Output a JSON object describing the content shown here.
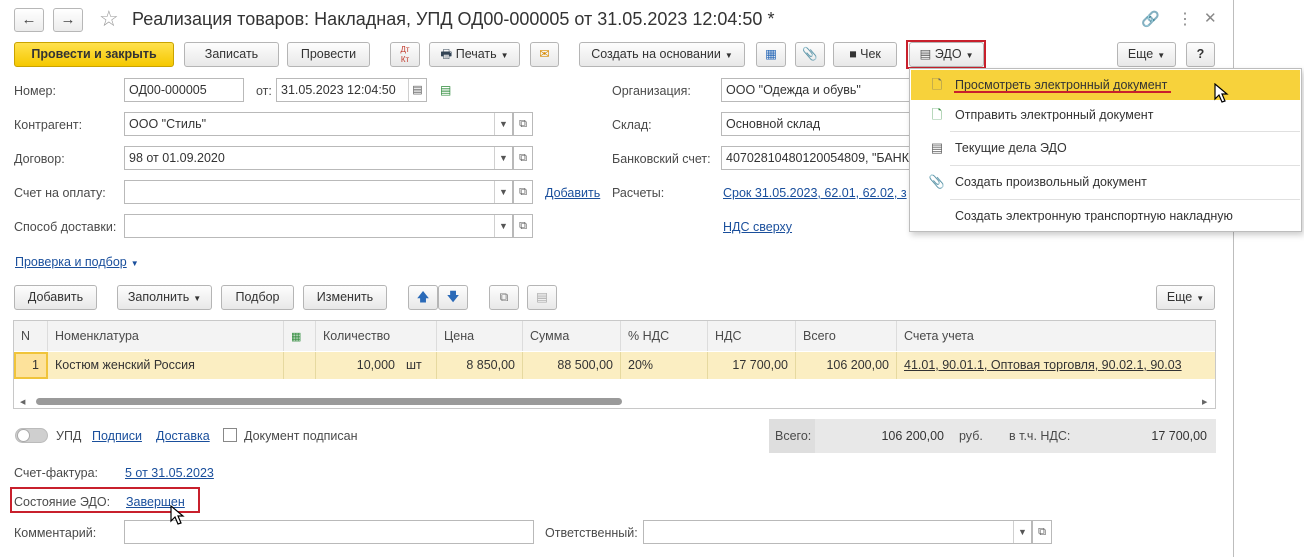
{
  "header": {
    "back_icon": "arrow-left-icon",
    "forward_icon": "arrow-right-icon",
    "title": "Реализация товаров: Накладная, УПД ОД00-000005 от 31.05.2023 12:04:50 *"
  },
  "toolbar": {
    "post_close": "Провести и закрыть",
    "save": "Записать",
    "post": "Провести",
    "dtkt": "Дт Кт",
    "print": "Печать",
    "create_based": "Создать на основании",
    "receipt": "Чек",
    "edo": "ЭДО",
    "more": "Еще",
    "help": "?"
  },
  "form": {
    "number_label": "Номер:",
    "number_value": "ОД00-000005",
    "date_label": "от:",
    "date_value": "31.05.2023 12:04:50",
    "org_label": "Организация:",
    "org_value": "ООО \"Одежда и обувь\"",
    "counterparty_label": "Контрагент:",
    "counterparty_value": "ООО \"Стиль\"",
    "warehouse_label": "Склад:",
    "warehouse_value": "Основной склад",
    "contract_label": "Договор:",
    "contract_value": "98 от 01.09.2020",
    "bank_label": "Банковский счет:",
    "bank_value": "40702810480120054809, \"БАНК",
    "invoice_label": "Счет на оплату:",
    "invoice_value": "",
    "add_link": "Добавить",
    "settlements_label": "Расчеты:",
    "settlements_link": "Срок 31.05.2023, 62.01, 62.02, з",
    "delivery_label": "Способ доставки:",
    "delivery_value": "",
    "vat_link": "НДС сверху",
    "check_link": "Проверка и подбор"
  },
  "table_toolbar": {
    "add": "Добавить",
    "fill": "Заполнить",
    "pick": "Подбор",
    "change": "Изменить",
    "more": "Еще"
  },
  "table": {
    "headers": [
      "N",
      "Номенклатура",
      "",
      "Количество",
      "Цена",
      "Сумма",
      "% НДС",
      "НДС",
      "Всего",
      "Счета учета"
    ],
    "rows": [
      {
        "n": "1",
        "item": "Костюм женский Россия",
        "qty": "10,000",
        "unit": "шт",
        "price": "8 850,00",
        "sum": "88 500,00",
        "vat_rate": "20%",
        "vat": "17 700,00",
        "total": "106 200,00",
        "accounts": "41.01, 90.01.1, Оптовая торговля, 90.02.1, 90.03"
      }
    ]
  },
  "footer": {
    "upd_label": "УПД",
    "signatures_link": "Подписи",
    "delivery_link": "Доставка",
    "signed_label": "Документ подписан",
    "total_label": "Всего:",
    "total_value": "106 200,00",
    "currency": "руб.",
    "vat_incl_label": "в т.ч. НДС:",
    "vat_incl_value": "17 700,00",
    "invoice_label": "Счет-фактура:",
    "invoice_link": "5 от 31.05.2023",
    "edo_state_label": "Состояние ЭДО:",
    "edo_state_link": "Завершен",
    "comment_label": "Комментарий:",
    "comment_value": "",
    "responsible_label": "Ответственный:",
    "responsible_value": ""
  },
  "edo_menu": {
    "items": [
      {
        "label": "Просмотреть электронный документ",
        "icon": "document-icon"
      },
      {
        "label": "Отправить электронный документ",
        "icon": "send-document-icon"
      },
      {
        "label": "Текущие дела ЭДО",
        "icon": "edo-tasks-icon"
      },
      {
        "label": "Создать произвольный документ",
        "icon": "paperclip-icon"
      },
      {
        "label": "Создать электронную транспортную накладную",
        "icon": ""
      }
    ]
  },
  "colors": {
    "accent_yellow": "#f5c800",
    "highlight_row": "#fbeec2",
    "link_blue": "#1a4f9c",
    "annotation_red": "#c8202c"
  }
}
